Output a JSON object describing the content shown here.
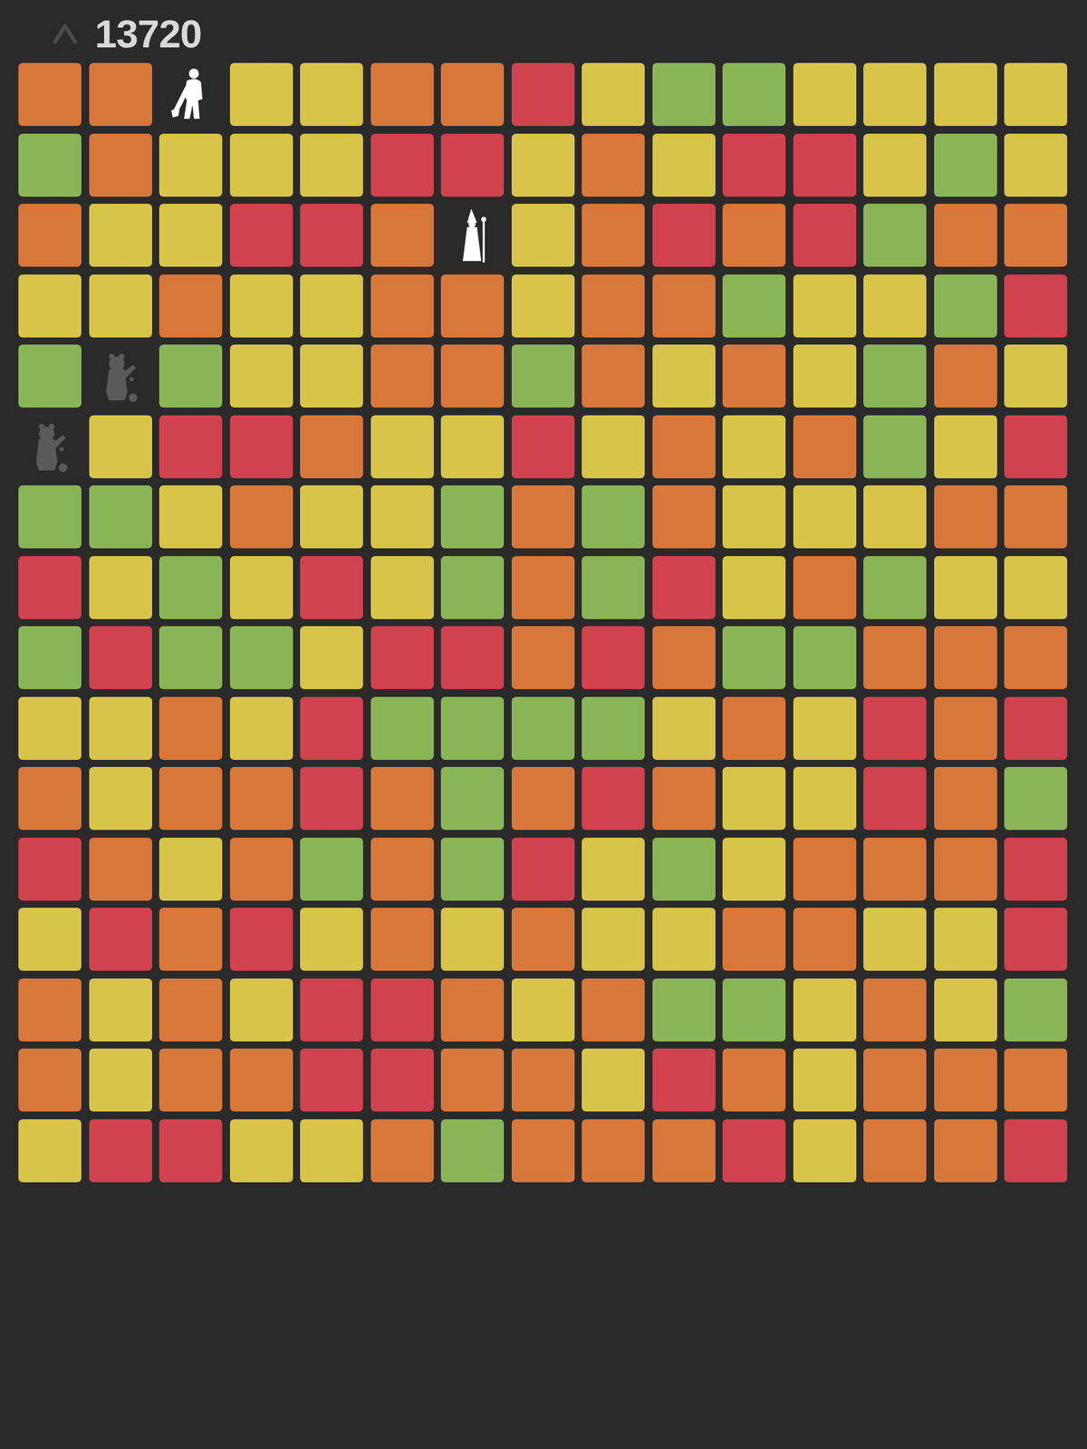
{
  "header": {
    "score": "13720"
  },
  "grid": {
    "rows": [
      [
        {
          "kind": "tile",
          "color": "#d8773a"
        },
        {
          "kind": "tile",
          "color": "#d8773a"
        },
        {
          "kind": "hero",
          "dimmed": false
        },
        {
          "kind": "tile",
          "color": "#d9c44a"
        },
        {
          "kind": "tile",
          "color": "#d9c44a"
        },
        {
          "kind": "tile",
          "color": "#d8773a"
        },
        {
          "kind": "tile",
          "color": "#d8773a"
        },
        {
          "kind": "tile",
          "color": "#d0424e"
        },
        {
          "kind": "tile",
          "color": "#d9c44a"
        },
        {
          "kind": "tile",
          "color": "#8ab556"
        },
        {
          "kind": "tile",
          "color": "#8ab556"
        },
        {
          "kind": "tile",
          "color": "#d9c44a"
        },
        {
          "kind": "tile",
          "color": "#d9c44a"
        },
        {
          "kind": "tile",
          "color": "#d9c44a"
        },
        {
          "kind": "tile",
          "color": "#d9c44a"
        }
      ],
      [
        {
          "kind": "tile",
          "color": "#8ab556"
        },
        {
          "kind": "tile",
          "color": "#d8773a"
        },
        {
          "kind": "tile",
          "color": "#d9c44a"
        },
        {
          "kind": "tile",
          "color": "#d9c44a"
        },
        {
          "kind": "tile",
          "color": "#d9c44a"
        },
        {
          "kind": "tile",
          "color": "#d0424e"
        },
        {
          "kind": "tile",
          "color": "#d0424e"
        },
        {
          "kind": "tile",
          "color": "#d9c44a"
        },
        {
          "kind": "tile",
          "color": "#d8773a"
        },
        {
          "kind": "tile",
          "color": "#d9c44a"
        },
        {
          "kind": "tile",
          "color": "#d0424e"
        },
        {
          "kind": "tile",
          "color": "#d0424e"
        },
        {
          "kind": "tile",
          "color": "#d9c44a"
        },
        {
          "kind": "tile",
          "color": "#8ab556"
        },
        {
          "kind": "tile",
          "color": "#d9c44a"
        }
      ],
      [
        {
          "kind": "tile",
          "color": "#d8773a"
        },
        {
          "kind": "tile",
          "color": "#d9c44a"
        },
        {
          "kind": "tile",
          "color": "#d9c44a"
        },
        {
          "kind": "tile",
          "color": "#d0424e"
        },
        {
          "kind": "tile",
          "color": "#d0424e"
        },
        {
          "kind": "tile",
          "color": "#d8773a"
        },
        {
          "kind": "wizard",
          "dimmed": false
        },
        {
          "kind": "tile",
          "color": "#d9c44a"
        },
        {
          "kind": "tile",
          "color": "#d8773a"
        },
        {
          "kind": "tile",
          "color": "#d0424e"
        },
        {
          "kind": "tile",
          "color": "#d8773a"
        },
        {
          "kind": "tile",
          "color": "#d0424e"
        },
        {
          "kind": "tile",
          "color": "#8ab556"
        },
        {
          "kind": "tile",
          "color": "#d8773a"
        },
        {
          "kind": "tile",
          "color": "#d8773a"
        }
      ],
      [
        {
          "kind": "tile",
          "color": "#d9c44a"
        },
        {
          "kind": "tile",
          "color": "#d9c44a"
        },
        {
          "kind": "tile",
          "color": "#d8773a"
        },
        {
          "kind": "tile",
          "color": "#d9c44a"
        },
        {
          "kind": "tile",
          "color": "#d9c44a"
        },
        {
          "kind": "tile",
          "color": "#d8773a"
        },
        {
          "kind": "tile",
          "color": "#d8773a"
        },
        {
          "kind": "tile",
          "color": "#d9c44a"
        },
        {
          "kind": "tile",
          "color": "#d8773a"
        },
        {
          "kind": "tile",
          "color": "#d8773a"
        },
        {
          "kind": "tile",
          "color": "#8ab556"
        },
        {
          "kind": "tile",
          "color": "#d9c44a"
        },
        {
          "kind": "tile",
          "color": "#d9c44a"
        },
        {
          "kind": "tile",
          "color": "#8ab556"
        },
        {
          "kind": "tile",
          "color": "#d0424e"
        }
      ],
      [
        {
          "kind": "tile",
          "color": "#8ab556"
        },
        {
          "kind": "bear",
          "dimmed": true
        },
        {
          "kind": "tile",
          "color": "#8ab556"
        },
        {
          "kind": "tile",
          "color": "#d9c44a"
        },
        {
          "kind": "tile",
          "color": "#d9c44a"
        },
        {
          "kind": "tile",
          "color": "#d8773a"
        },
        {
          "kind": "tile",
          "color": "#d8773a"
        },
        {
          "kind": "tile",
          "color": "#8ab556"
        },
        {
          "kind": "tile",
          "color": "#d8773a"
        },
        {
          "kind": "tile",
          "color": "#d9c44a"
        },
        {
          "kind": "tile",
          "color": "#d8773a"
        },
        {
          "kind": "tile",
          "color": "#d9c44a"
        },
        {
          "kind": "tile",
          "color": "#8ab556"
        },
        {
          "kind": "tile",
          "color": "#d8773a"
        },
        {
          "kind": "tile",
          "color": "#d9c44a"
        }
      ],
      [
        {
          "kind": "bear",
          "dimmed": true
        },
        {
          "kind": "tile",
          "color": "#d9c44a"
        },
        {
          "kind": "tile",
          "color": "#d0424e"
        },
        {
          "kind": "tile",
          "color": "#d0424e"
        },
        {
          "kind": "tile",
          "color": "#d8773a"
        },
        {
          "kind": "tile",
          "color": "#d9c44a"
        },
        {
          "kind": "tile",
          "color": "#d9c44a"
        },
        {
          "kind": "tile",
          "color": "#d0424e"
        },
        {
          "kind": "tile",
          "color": "#d9c44a"
        },
        {
          "kind": "tile",
          "color": "#d8773a"
        },
        {
          "kind": "tile",
          "color": "#d9c44a"
        },
        {
          "kind": "tile",
          "color": "#d8773a"
        },
        {
          "kind": "tile",
          "color": "#8ab556"
        },
        {
          "kind": "tile",
          "color": "#d9c44a"
        },
        {
          "kind": "tile",
          "color": "#d0424e"
        }
      ],
      [
        {
          "kind": "tile",
          "color": "#8ab556"
        },
        {
          "kind": "tile",
          "color": "#8ab556"
        },
        {
          "kind": "tile",
          "color": "#d9c44a"
        },
        {
          "kind": "tile",
          "color": "#d8773a"
        },
        {
          "kind": "tile",
          "color": "#d9c44a"
        },
        {
          "kind": "tile",
          "color": "#d9c44a"
        },
        {
          "kind": "tile",
          "color": "#8ab556"
        },
        {
          "kind": "tile",
          "color": "#d8773a"
        },
        {
          "kind": "tile",
          "color": "#8ab556"
        },
        {
          "kind": "tile",
          "color": "#d8773a"
        },
        {
          "kind": "tile",
          "color": "#d9c44a"
        },
        {
          "kind": "tile",
          "color": "#d9c44a"
        },
        {
          "kind": "tile",
          "color": "#d9c44a"
        },
        {
          "kind": "tile",
          "color": "#d8773a"
        },
        {
          "kind": "tile",
          "color": "#d8773a"
        }
      ],
      [
        {
          "kind": "tile",
          "color": "#d0424e"
        },
        {
          "kind": "tile",
          "color": "#d9c44a"
        },
        {
          "kind": "tile",
          "color": "#8ab556"
        },
        {
          "kind": "tile",
          "color": "#d9c44a"
        },
        {
          "kind": "tile",
          "color": "#d0424e"
        },
        {
          "kind": "tile",
          "color": "#d9c44a"
        },
        {
          "kind": "tile",
          "color": "#8ab556"
        },
        {
          "kind": "tile",
          "color": "#d8773a"
        },
        {
          "kind": "tile",
          "color": "#8ab556"
        },
        {
          "kind": "tile",
          "color": "#d0424e"
        },
        {
          "kind": "tile",
          "color": "#d9c44a"
        },
        {
          "kind": "tile",
          "color": "#d8773a"
        },
        {
          "kind": "tile",
          "color": "#8ab556"
        },
        {
          "kind": "tile",
          "color": "#d9c44a"
        },
        {
          "kind": "tile",
          "color": "#d9c44a"
        }
      ],
      [
        {
          "kind": "tile",
          "color": "#8ab556"
        },
        {
          "kind": "tile",
          "color": "#d0424e"
        },
        {
          "kind": "tile",
          "color": "#8ab556"
        },
        {
          "kind": "tile",
          "color": "#8ab556"
        },
        {
          "kind": "tile",
          "color": "#d9c44a"
        },
        {
          "kind": "tile",
          "color": "#d0424e"
        },
        {
          "kind": "tile",
          "color": "#d0424e"
        },
        {
          "kind": "tile",
          "color": "#d8773a"
        },
        {
          "kind": "tile",
          "color": "#d0424e"
        },
        {
          "kind": "tile",
          "color": "#d8773a"
        },
        {
          "kind": "tile",
          "color": "#8ab556"
        },
        {
          "kind": "tile",
          "color": "#8ab556"
        },
        {
          "kind": "tile",
          "color": "#d8773a"
        },
        {
          "kind": "tile",
          "color": "#d8773a"
        },
        {
          "kind": "tile",
          "color": "#d8773a"
        }
      ],
      [
        {
          "kind": "tile",
          "color": "#d9c44a"
        },
        {
          "kind": "tile",
          "color": "#d9c44a"
        },
        {
          "kind": "tile",
          "color": "#d8773a"
        },
        {
          "kind": "tile",
          "color": "#d9c44a"
        },
        {
          "kind": "tile",
          "color": "#d0424e"
        },
        {
          "kind": "tile",
          "color": "#8ab556"
        },
        {
          "kind": "tile",
          "color": "#8ab556"
        },
        {
          "kind": "tile",
          "color": "#8ab556"
        },
        {
          "kind": "tile",
          "color": "#8ab556"
        },
        {
          "kind": "tile",
          "color": "#d9c44a"
        },
        {
          "kind": "tile",
          "color": "#d8773a"
        },
        {
          "kind": "tile",
          "color": "#d9c44a"
        },
        {
          "kind": "tile",
          "color": "#d0424e"
        },
        {
          "kind": "tile",
          "color": "#d8773a"
        },
        {
          "kind": "tile",
          "color": "#d0424e"
        }
      ],
      [
        {
          "kind": "tile",
          "color": "#d8773a"
        },
        {
          "kind": "tile",
          "color": "#d9c44a"
        },
        {
          "kind": "tile",
          "color": "#d8773a"
        },
        {
          "kind": "tile",
          "color": "#d8773a"
        },
        {
          "kind": "tile",
          "color": "#d0424e"
        },
        {
          "kind": "tile",
          "color": "#d8773a"
        },
        {
          "kind": "tile",
          "color": "#8ab556"
        },
        {
          "kind": "tile",
          "color": "#d8773a"
        },
        {
          "kind": "tile",
          "color": "#d0424e"
        },
        {
          "kind": "tile",
          "color": "#d8773a"
        },
        {
          "kind": "tile",
          "color": "#d9c44a"
        },
        {
          "kind": "tile",
          "color": "#d9c44a"
        },
        {
          "kind": "tile",
          "color": "#d0424e"
        },
        {
          "kind": "tile",
          "color": "#d8773a"
        },
        {
          "kind": "tile",
          "color": "#8ab556"
        }
      ],
      [
        {
          "kind": "tile",
          "color": "#d0424e"
        },
        {
          "kind": "tile",
          "color": "#d8773a"
        },
        {
          "kind": "tile",
          "color": "#d9c44a"
        },
        {
          "kind": "tile",
          "color": "#d8773a"
        },
        {
          "kind": "tile",
          "color": "#8ab556"
        },
        {
          "kind": "tile",
          "color": "#d8773a"
        },
        {
          "kind": "tile",
          "color": "#8ab556"
        },
        {
          "kind": "tile",
          "color": "#d0424e"
        },
        {
          "kind": "tile",
          "color": "#d9c44a"
        },
        {
          "kind": "tile",
          "color": "#8ab556"
        },
        {
          "kind": "tile",
          "color": "#d9c44a"
        },
        {
          "kind": "tile",
          "color": "#d8773a"
        },
        {
          "kind": "tile",
          "color": "#d8773a"
        },
        {
          "kind": "tile",
          "color": "#d8773a"
        },
        {
          "kind": "tile",
          "color": "#d0424e"
        }
      ],
      [
        {
          "kind": "tile",
          "color": "#d9c44a"
        },
        {
          "kind": "tile",
          "color": "#d0424e"
        },
        {
          "kind": "tile",
          "color": "#d8773a"
        },
        {
          "kind": "tile",
          "color": "#d0424e"
        },
        {
          "kind": "tile",
          "color": "#d9c44a"
        },
        {
          "kind": "tile",
          "color": "#d8773a"
        },
        {
          "kind": "tile",
          "color": "#d9c44a"
        },
        {
          "kind": "tile",
          "color": "#d8773a"
        },
        {
          "kind": "tile",
          "color": "#d9c44a"
        },
        {
          "kind": "tile",
          "color": "#d9c44a"
        },
        {
          "kind": "tile",
          "color": "#d8773a"
        },
        {
          "kind": "tile",
          "color": "#d8773a"
        },
        {
          "kind": "tile",
          "color": "#d9c44a"
        },
        {
          "kind": "tile",
          "color": "#d9c44a"
        },
        {
          "kind": "tile",
          "color": "#d0424e"
        }
      ],
      [
        {
          "kind": "tile",
          "color": "#d8773a"
        },
        {
          "kind": "tile",
          "color": "#d9c44a"
        },
        {
          "kind": "tile",
          "color": "#d8773a"
        },
        {
          "kind": "tile",
          "color": "#d9c44a"
        },
        {
          "kind": "tile",
          "color": "#d0424e"
        },
        {
          "kind": "tile",
          "color": "#d0424e"
        },
        {
          "kind": "tile",
          "color": "#d8773a"
        },
        {
          "kind": "tile",
          "color": "#d9c44a"
        },
        {
          "kind": "tile",
          "color": "#d8773a"
        },
        {
          "kind": "tile",
          "color": "#8ab556"
        },
        {
          "kind": "tile",
          "color": "#8ab556"
        },
        {
          "kind": "tile",
          "color": "#d9c44a"
        },
        {
          "kind": "tile",
          "color": "#d8773a"
        },
        {
          "kind": "tile",
          "color": "#d9c44a"
        },
        {
          "kind": "tile",
          "color": "#8ab556"
        }
      ],
      [
        {
          "kind": "tile",
          "color": "#d8773a"
        },
        {
          "kind": "tile",
          "color": "#d9c44a"
        },
        {
          "kind": "tile",
          "color": "#d8773a"
        },
        {
          "kind": "tile",
          "color": "#d8773a"
        },
        {
          "kind": "tile",
          "color": "#d0424e"
        },
        {
          "kind": "tile",
          "color": "#d0424e"
        },
        {
          "kind": "tile",
          "color": "#d8773a"
        },
        {
          "kind": "tile",
          "color": "#d8773a"
        },
        {
          "kind": "tile",
          "color": "#d9c44a"
        },
        {
          "kind": "tile",
          "color": "#d0424e"
        },
        {
          "kind": "tile",
          "color": "#d8773a"
        },
        {
          "kind": "tile",
          "color": "#d9c44a"
        },
        {
          "kind": "tile",
          "color": "#d8773a"
        },
        {
          "kind": "tile",
          "color": "#d8773a"
        },
        {
          "kind": "tile",
          "color": "#d8773a"
        }
      ],
      [
        {
          "kind": "tile",
          "color": "#d9c44a"
        },
        {
          "kind": "tile",
          "color": "#d0424e"
        },
        {
          "kind": "tile",
          "color": "#d0424e"
        },
        {
          "kind": "tile",
          "color": "#d9c44a"
        },
        {
          "kind": "tile",
          "color": "#d9c44a"
        },
        {
          "kind": "tile",
          "color": "#d8773a"
        },
        {
          "kind": "tile",
          "color": "#8ab556"
        },
        {
          "kind": "tile",
          "color": "#d8773a"
        },
        {
          "kind": "tile",
          "color": "#d8773a"
        },
        {
          "kind": "tile",
          "color": "#d8773a"
        },
        {
          "kind": "tile",
          "color": "#d0424e"
        },
        {
          "kind": "tile",
          "color": "#d9c44a"
        },
        {
          "kind": "tile",
          "color": "#d8773a"
        },
        {
          "kind": "tile",
          "color": "#d8773a"
        },
        {
          "kind": "tile",
          "color": "#d0424e"
        }
      ]
    ]
  }
}
